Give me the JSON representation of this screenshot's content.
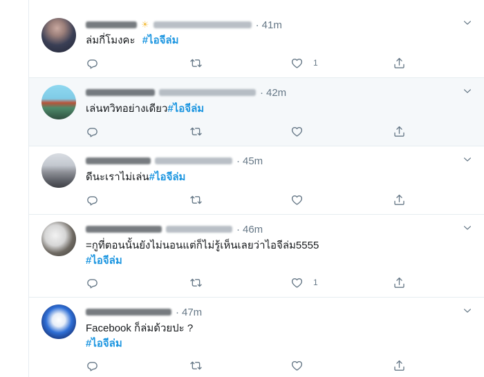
{
  "tweets": [
    {
      "time": "41m",
      "text": "ล่มกี่โมงคะ",
      "hashtag": "#ไอจีล่ม",
      "likes": "1"
    },
    {
      "time": "42m",
      "text": "เล่นทวิทอย่างเดียว",
      "hashtag": "#ไอจีล่ม",
      "likes": ""
    },
    {
      "time": "45m",
      "text": "ดีนะเราไม่เล่น",
      "hashtag": "#ไอจีล่ม",
      "likes": ""
    },
    {
      "time": "46m",
      "text": "=กูที่ตอนนั้นยังไม่นอนแต่ก็ไม่รู้เห็นเลยว่าไอจีล่ม5555",
      "hashtag": "#ไอจีล่ม",
      "likes": "1"
    },
    {
      "time": "47m",
      "text": "Facebook ก็ล่มด้วยปะ ?",
      "hashtag": "#ไอจีล่ม",
      "likes": ""
    }
  ],
  "separator": "·",
  "icons": {
    "reply": "reply-icon",
    "retweet": "retweet-icon",
    "like": "heart-icon",
    "share": "share-icon",
    "menu": "chevron-down-icon",
    "badge": "sun-emoji-icon"
  },
  "colors": {
    "hashtag": "#1b95e0",
    "meta": "#657786",
    "highlight_bg": "#f5f8fa",
    "divider": "#e6ecf0"
  }
}
